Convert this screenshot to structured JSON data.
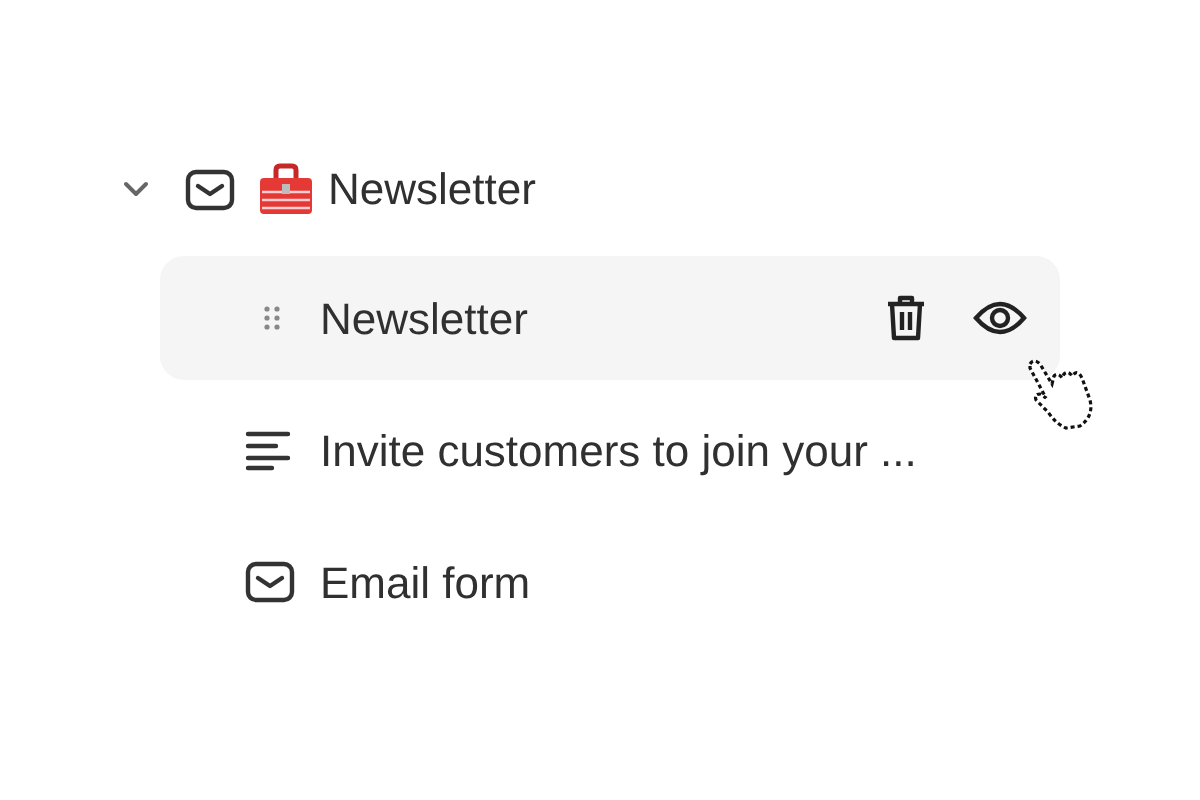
{
  "tree": {
    "label": "Newsletter",
    "expanded": true,
    "children": [
      {
        "kind": "section",
        "label": "Newsletter",
        "selected": true
      },
      {
        "kind": "text",
        "label": "Invite customers to join your ...",
        "selected": false
      },
      {
        "kind": "email",
        "label": "Email form",
        "selected": false
      }
    ]
  }
}
